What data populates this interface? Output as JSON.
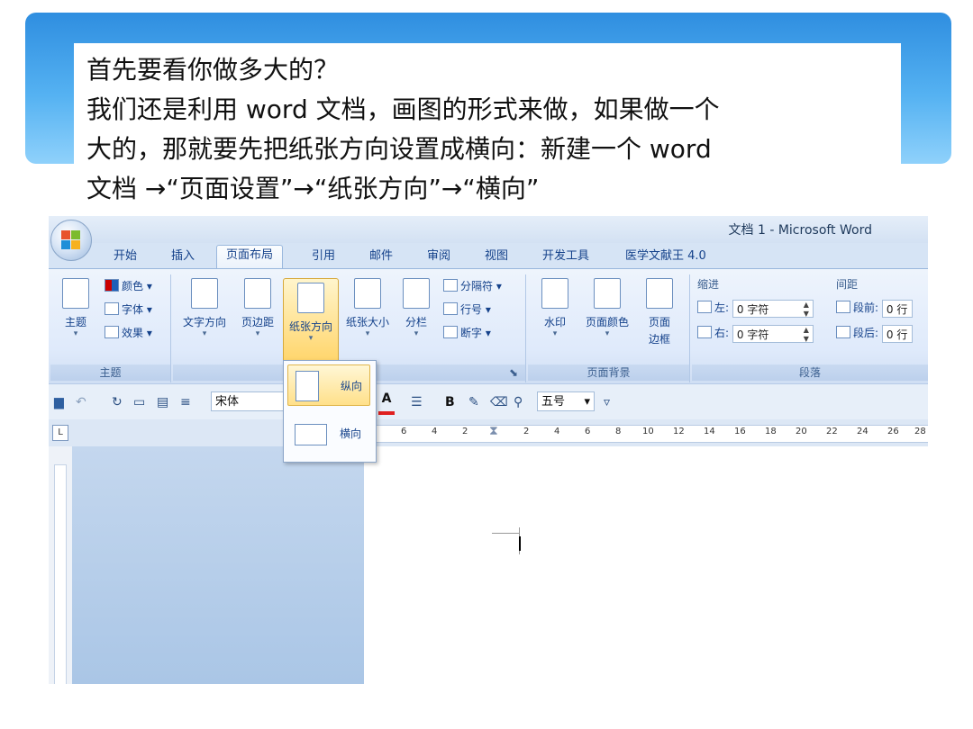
{
  "slide": {
    "lines": [
      "首先要看你做多大的？",
      "我们还是利用 word 文档，画图的形式来做，如果做一个",
      "大的，那就要先把纸张方向设置成横向：新建一个 word",
      "文档 →“页面设置”→“纸张方向”→“横向”"
    ]
  },
  "window": {
    "title": "文档 1 - Microsoft Word"
  },
  "tabs": [
    "开始",
    "插入",
    "页面布局",
    "引用",
    "邮件",
    "审阅",
    "视图",
    "开发工具",
    "医学文献王 4.0"
  ],
  "ribbon": {
    "theme_group": {
      "label": "主题",
      "main": "主题",
      "colors": "颜色",
      "fonts": "字体",
      "effects": "效果"
    },
    "page_setup_group": {
      "text_direction": "文字方向",
      "margins": "页边距",
      "orientation": "纸张方向",
      "size": "纸张大小",
      "columns": "分栏",
      "breaks": "分隔符",
      "line_numbers": "行号",
      "hyphenation": "断字"
    },
    "background_group": {
      "label": "页面背景",
      "watermark": "水印",
      "page_color": "页面颜色",
      "page_borders_1": "页面",
      "page_borders_2": "边框"
    },
    "paragraph_group": {
      "label": "段落",
      "indent_title": "缩进",
      "spacing_title": "间距",
      "left_label": "左:",
      "right_label": "右:",
      "left_value": "0 字符",
      "right_value": "0 字符",
      "before_label": "段前:",
      "after_label": "段后:",
      "before_value": "0 行",
      "after_value": "0 行"
    }
  },
  "toolbar": {
    "font": "宋体",
    "size": "五号"
  },
  "orientation_menu": {
    "portrait": "纵向",
    "landscape": "横向"
  },
  "ruler": {
    "ticks": [
      "6",
      "4",
      "2",
      "2",
      "4",
      "6",
      "8",
      "10",
      "12",
      "14",
      "16",
      "18",
      "20",
      "22",
      "24",
      "26",
      "28"
    ]
  }
}
